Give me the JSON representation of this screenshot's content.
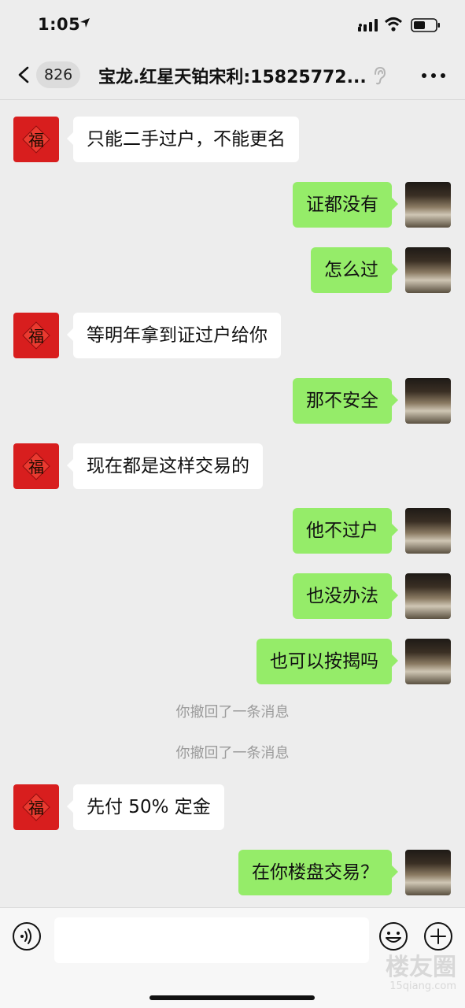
{
  "status_bar": {
    "time": "1:05"
  },
  "header": {
    "back_count": "826",
    "title": "宝龙.红星天铂宋利:15825772..."
  },
  "avatars": {
    "contact_glyph": "福"
  },
  "messages": [
    {
      "type": "in",
      "text": "只能二手过户，不能更名"
    },
    {
      "type": "out",
      "text": "证都没有"
    },
    {
      "type": "out",
      "text": "怎么过"
    },
    {
      "type": "in",
      "text": "等明年拿到证过户给你"
    },
    {
      "type": "out",
      "text": "那不安全"
    },
    {
      "type": "in",
      "text": "现在都是这样交易的"
    },
    {
      "type": "out",
      "text": "他不过户"
    },
    {
      "type": "out",
      "text": "也没办法"
    },
    {
      "type": "out",
      "text": "也可以按揭吗"
    },
    {
      "type": "system",
      "text": "你撤回了一条消息"
    },
    {
      "type": "system",
      "text": "你撤回了一条消息"
    },
    {
      "type": "in",
      "text": "先付 50% 定金"
    },
    {
      "type": "out",
      "text": "在你楼盘交易？"
    }
  ],
  "input": {
    "placeholder": "",
    "value": ""
  },
  "watermark": {
    "main": "楼友圈",
    "sub": "15qiang.com"
  },
  "icons": {
    "back": "chevron-left-icon",
    "ear": "ear-icon",
    "more": "more-icon",
    "voice": "voice-icon",
    "emoji": "emoji-icon",
    "plus": "plus-icon"
  },
  "colors": {
    "outgoing_bubble": "#95ec69",
    "incoming_bubble": "#ffffff",
    "background": "#ededed",
    "avatar_red": "#d81e1e"
  }
}
